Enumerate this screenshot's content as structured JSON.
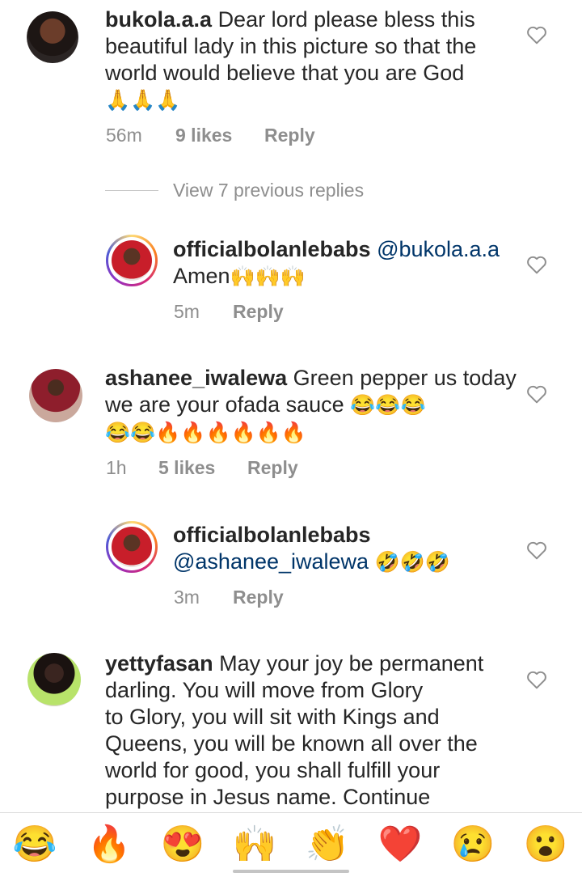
{
  "comments": [
    {
      "username": "bukola.a.a",
      "text": "Dear lord please bless this beautiful lady in this picture so that the world would believe that you are God",
      "emojis": "🙏🙏🙏",
      "time": "56m",
      "likes": "9 likes",
      "reply": "Reply"
    },
    {
      "view_replies": "View 7 previous replies"
    },
    {
      "username": "officialbolanlebabs",
      "mention": "@bukola.a.a",
      "text": "Amen",
      "emojis": "🙌🙌🙌",
      "time": "5m",
      "reply": "Reply"
    },
    {
      "username": "ashanee_iwalewa",
      "text": "Green pepper us today we are your ofada sauce",
      "emojis_line1": "😂😂😂",
      "emojis_line2": "😂😂🔥🔥🔥🔥🔥🔥",
      "time": "1h",
      "likes": "5 likes",
      "reply": "Reply"
    },
    {
      "username": "officialbolanlebabs",
      "mention": "@ashanee_iwalewa",
      "emojis": "🤣🤣🤣",
      "time": "3m",
      "reply": "Reply"
    },
    {
      "username": "yettyfasan",
      "text_line1": "May your joy be permanent",
      "text_line2": "darling. You will move from Glory",
      "text_line3": "to Glory, you will sit with Kings and",
      "text_line4": "Queens, you will be known all over the",
      "text_line5": "world for good, you shall fulfill your",
      "text_line6": "purpose in Jesus name. Continue"
    }
  ],
  "quick_reactions": [
    "😂",
    "🔥",
    "😍",
    "🙌",
    "👏",
    "❤️",
    "😢",
    "😮"
  ],
  "colors": {
    "mention": "#003569",
    "meta": "#8e8e8e",
    "text": "#262626"
  },
  "icons": {
    "like": "heart-outline-icon"
  }
}
